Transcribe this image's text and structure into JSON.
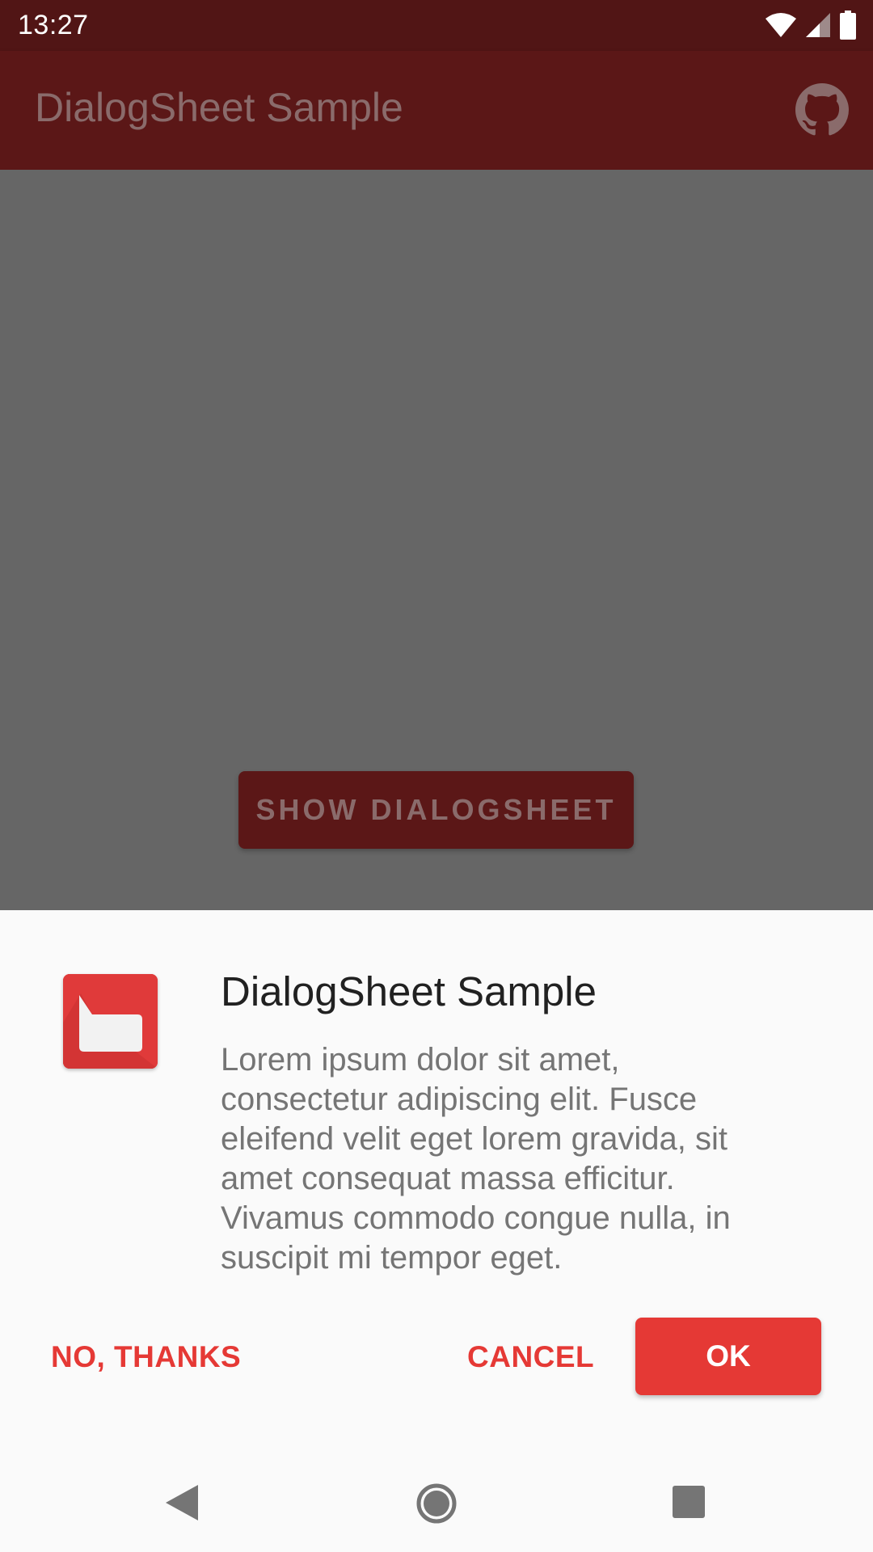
{
  "status_bar": {
    "time": "13:27",
    "icons": [
      "wifi-icon",
      "cell-signal-icon",
      "battery-icon"
    ]
  },
  "app_bar": {
    "title": "DialogSheet Sample",
    "action_icon": "github-icon"
  },
  "main": {
    "show_button_label": "SHOW DIALOGSHEET"
  },
  "dialog": {
    "icon": "dialog-app-icon",
    "title": "DialogSheet Sample",
    "message": "Lorem ipsum dolor sit amet, consectetur adipiscing elit. Fusce eleifend velit eget lorem gravida, sit amet consequat massa efficitur. Vivamus commodo congue nulla, in suscipit mi tempor eget.",
    "neutral_label": "NO, THANKS",
    "negative_label": "CANCEL",
    "positive_label": "OK"
  },
  "nav_bar": {
    "icons": [
      "back-icon",
      "home-icon",
      "recents-icon"
    ]
  },
  "colors": {
    "accent": "#e53935",
    "primary_dark_dimmed": "#511515",
    "primary_dimmed": "#5b1717",
    "scrim_background": "#666666",
    "sheet_background": "#fafafa"
  }
}
